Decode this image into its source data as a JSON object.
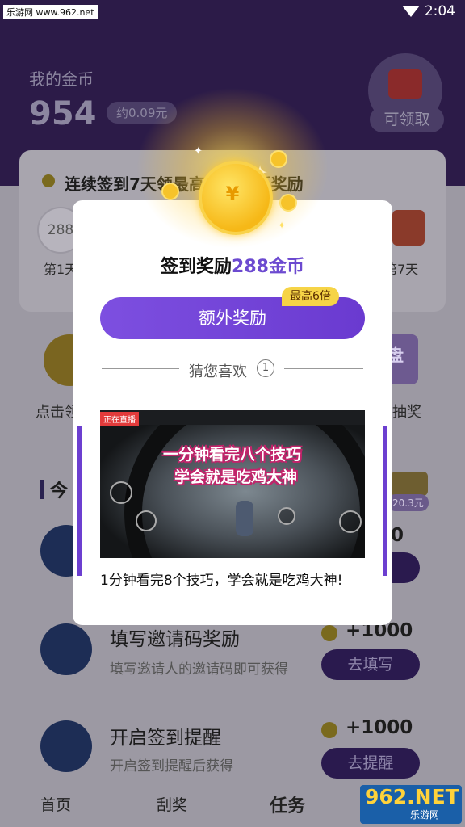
{
  "status_bar": {
    "watermark": "乐游网 www.962.net",
    "time": "2:04"
  },
  "header": {
    "coins_label": "我的金币",
    "coins_value": "954",
    "coins_approx": "约0.09元",
    "redpacket_label": "可领取"
  },
  "checkin": {
    "streak_text": "连续签到7天领最高288金币奖励",
    "day1_value": "288",
    "day1_label": "第1天",
    "day7_label": "第7天"
  },
  "features": {
    "left_label": "点击领",
    "right_label": "抽奖",
    "right_icon_text": "盘"
  },
  "today_section": {
    "title": "今",
    "bag_label": "20.3元",
    "first_reward_partial": "0"
  },
  "tasks": [
    {
      "title": "填写邀请码奖励",
      "subtitle": "填写邀请人的邀请码即可获得",
      "reward": "+1000",
      "button": "去填写"
    },
    {
      "title": "开启签到提醒",
      "subtitle": "开启签到提醒后获得",
      "reward": "+1000",
      "button": "去提醒"
    }
  ],
  "bottom_nav": [
    {
      "label": "首页"
    },
    {
      "label": "刮奖"
    },
    {
      "label": "任务"
    }
  ],
  "watermark": {
    "brand": "962.NET",
    "site": "乐游网"
  },
  "modal": {
    "title_prefix": "签到奖励",
    "title_amount": "288金币",
    "extra_button": "额外奖励",
    "extra_badge": "最高6倍",
    "guess_label": "猜您喜欢",
    "guess_index": "1",
    "video": {
      "live_tag": "正在直播",
      "caption_line1": "一分钟看完八个技巧",
      "caption_line2": "学会就是吃鸡大神"
    },
    "video_title": "1分钟看完8个技巧，学会就是吃鸡大神!"
  },
  "colors": {
    "accent": "#6c4ad0",
    "badge": "#f6d447",
    "header_bg": "#2c1b48"
  }
}
